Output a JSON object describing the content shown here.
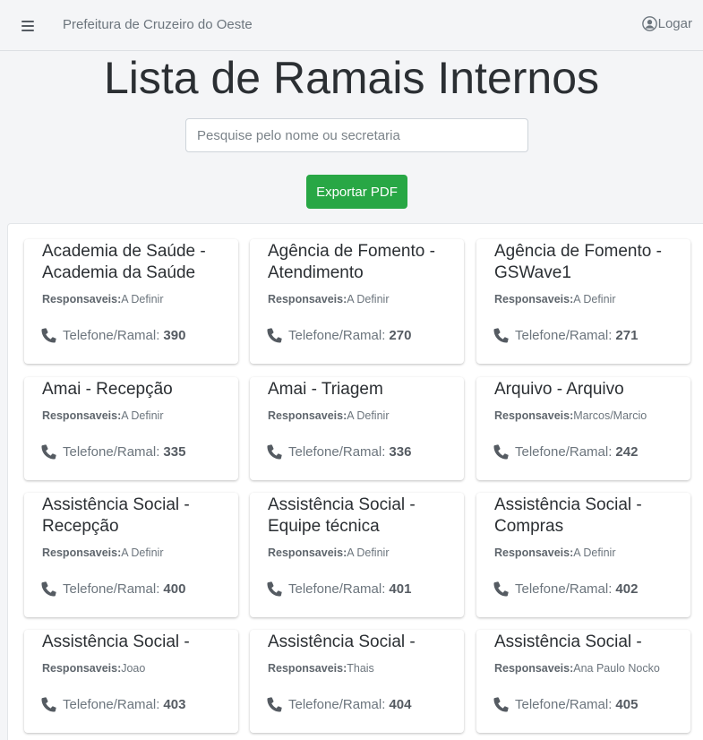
{
  "navbar": {
    "brand": "Prefeitura de Cruzeiro do Oeste",
    "login_label": "Logar"
  },
  "page": {
    "title": "Lista de Ramais Internos"
  },
  "search": {
    "placeholder": "Pesquise pelo nome ou secretaria",
    "value": ""
  },
  "export_button_label": "Exportar PDF",
  "labels": {
    "responsaveis": "Responsaveis:",
    "telefone": "Telefone/Ramal:"
  },
  "icons": {
    "menu": "hamburger-icon",
    "user": "user-circle-icon",
    "phone": "phone-icon"
  },
  "colors": {
    "export_button": "#28a745",
    "background": "#f4f5f7"
  },
  "cards": [
    {
      "title": "Academia de Saúde - Academia da Saúde",
      "responsaveis": "A Definir",
      "ramal": "390"
    },
    {
      "title": "Agência de Fomento - Atendimento",
      "responsaveis": "A Definir",
      "ramal": "270"
    },
    {
      "title": "Agência de Fomento - GSWave1",
      "responsaveis": "A Definir",
      "ramal": "271"
    },
    {
      "title": "Amai - Recepção",
      "responsaveis": "A Definir",
      "ramal": "335"
    },
    {
      "title": "Amai - Triagem",
      "responsaveis": "A Definir",
      "ramal": "336"
    },
    {
      "title": "Arquivo - Arquivo",
      "responsaveis": "Marcos/Marcio",
      "ramal": "242"
    },
    {
      "title": "Assistência Social - Recepção",
      "responsaveis": "A Definir",
      "ramal": "400"
    },
    {
      "title": "Assistência Social - Equipe técnica",
      "responsaveis": "A Definir",
      "ramal": "401"
    },
    {
      "title": "Assistência Social - Compras",
      "responsaveis": "A Definir",
      "ramal": "402"
    },
    {
      "title": "Assistência Social -",
      "responsaveis": "Joao",
      "ramal": "403"
    },
    {
      "title": "Assistência Social -",
      "responsaveis": "Thais",
      "ramal": "404"
    },
    {
      "title": "Assistência Social -",
      "responsaveis": "Ana Paulo Nocko",
      "ramal": "405"
    }
  ]
}
